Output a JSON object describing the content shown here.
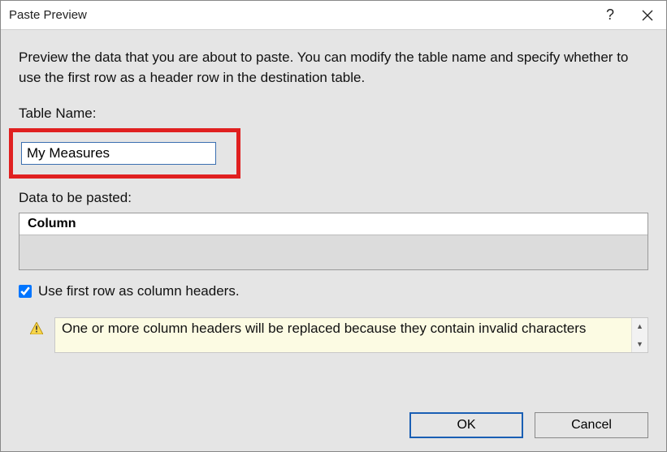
{
  "titlebar": {
    "title": "Paste Preview",
    "help": "?",
    "close": "✕"
  },
  "dialog": {
    "description": "Preview the data that you are about to paste. You can modify the table name and specify whether to use the first row as a header row in the destination table.",
    "table_name_label": "Table Name:",
    "table_name_value": "My Measures",
    "data_label": "Data to be pasted:",
    "column_header": "Column",
    "checkbox_label": "Use first row as column headers.",
    "warning_text": "One or more column headers will be replaced because they contain invalid characters"
  },
  "buttons": {
    "ok": "OK",
    "cancel": "Cancel"
  },
  "scroll": {
    "up": "▲",
    "down": "▼"
  }
}
